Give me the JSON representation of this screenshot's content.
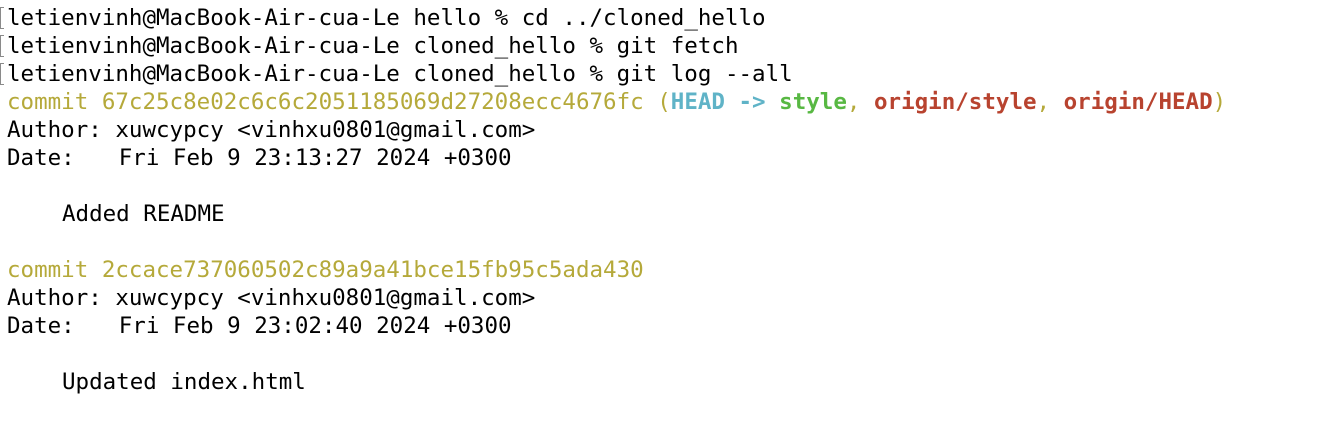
{
  "terminal": {
    "prompts": [
      {
        "prompt": "letienvinh@MacBook-Air-cua-Le hello % ",
        "command": "cd ../cloned_hello"
      },
      {
        "prompt": "letienvinh@MacBook-Air-cua-Le cloned_hello % ",
        "command": "git fetch"
      },
      {
        "prompt": "letienvinh@MacBook-Air-cua-Le cloned_hello % ",
        "command": "git log --all"
      }
    ],
    "commits": [
      {
        "commit_word": "commit ",
        "hash": "67c25c8e02c6c6c2051185069d27208ecc4676fc",
        "refs": {
          "open": " (",
          "head": "HEAD -> ",
          "branch": "style",
          "sep1": ", ",
          "remote1": "origin/style",
          "sep2": ", ",
          "remote2": "origin/HEAD",
          "close": ")"
        },
        "author_label": "Author:",
        "author": " xuwcypcy <vinhxu0801@gmail.com>",
        "date_label": "Date:",
        "date": "Fri Feb 9 23:13:27 2024 +0300",
        "message": "Added README"
      },
      {
        "commit_word": "commit ",
        "hash": "2ccace737060502c89a9a41bce15fb95c5ada430",
        "author_label": "Author:",
        "author": " xuwcypcy <vinhxu0801@gmail.com>",
        "date_label": "Date:",
        "date": "Fri Feb 9 23:02:40 2024 +0300",
        "message": "Updated index.html"
      }
    ]
  },
  "colors": {
    "commit": "#b5a93a",
    "head": "#5fb3c7",
    "branch": "#58b843",
    "remote": "#b8432f"
  }
}
